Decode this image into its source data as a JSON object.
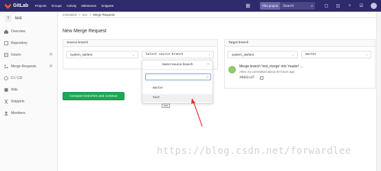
{
  "navbar": {
    "brand": "GitLab",
    "links": [
      "Projects",
      "Groups",
      "Activity",
      "Milestones",
      "Snippets"
    ],
    "search_scope": "This project",
    "search_placeholder": "Search"
  },
  "sidebar": {
    "project_initial": "T",
    "project_name": "test",
    "items": [
      {
        "label": "Overview",
        "icon": "home-icon"
      },
      {
        "label": "Repository",
        "icon": "book-icon"
      },
      {
        "label": "Issues",
        "icon": "issues-icon",
        "count": "0"
      },
      {
        "label": "Merge Requests",
        "icon": "merge-request-icon",
        "count": "0"
      },
      {
        "label": "CI / CD",
        "icon": "rocket-icon"
      },
      {
        "label": "Wiki",
        "icon": "book-icon"
      },
      {
        "label": "Snippets",
        "icon": "clipboard-icon"
      },
      {
        "label": "Members",
        "icon": "users-icon"
      }
    ]
  },
  "breadcrumb": {
    "items": [
      "embedded",
      "test",
      "Merge Requests"
    ],
    "separator": ">"
  },
  "page_title": "New Merge Request",
  "source": {
    "header": "Source branch",
    "project_select": "system_sw/test",
    "branch_select": "Select source branch"
  },
  "target": {
    "header": "Target branch",
    "project_select": "system_sw/test",
    "branch_select": "master"
  },
  "dropdown": {
    "title": "Select source branch",
    "close": "×",
    "items": [
      "master",
      "test"
    ],
    "tooltip": "test"
  },
  "commit": {
    "title": "Merge branch 'test_merge' into 'master'",
    "more": "...",
    "meta": "Allen Xu committed about 20 hours ago",
    "sha": "39d42cd7"
  },
  "compare_button": "Compare branches and continue",
  "watermark": "https://blog.csdn.net/forwardlee",
  "colors": {
    "navbar": "#2f2a6b",
    "button_green": "#1aaa55",
    "arrow_red": "#e0342b"
  }
}
